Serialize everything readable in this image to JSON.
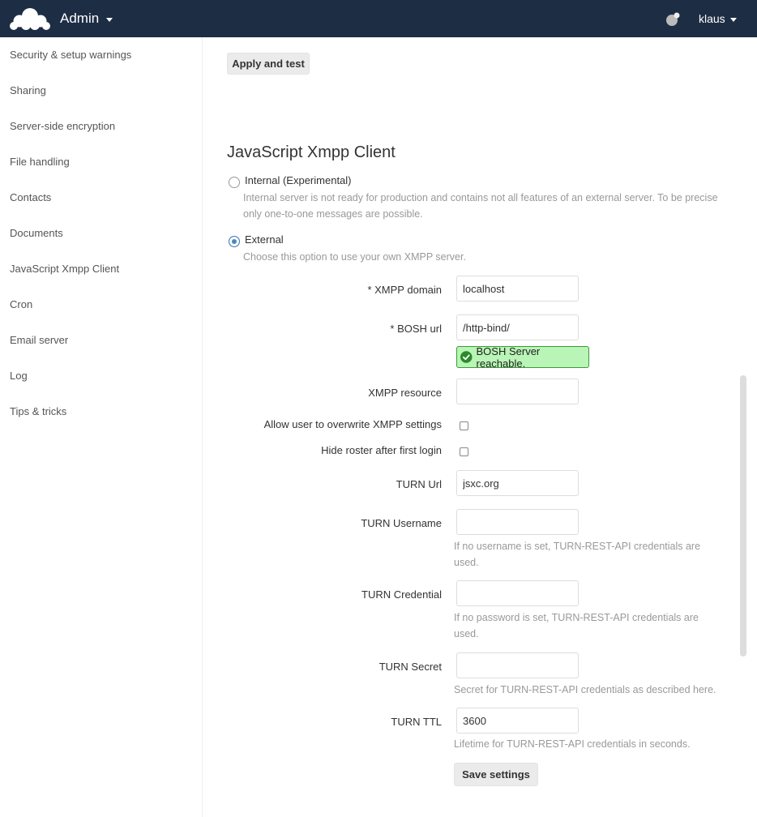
{
  "header": {
    "app_name": "Admin",
    "user": "klaus"
  },
  "sidebar": {
    "items": [
      {
        "label": "Security & setup warnings"
      },
      {
        "label": "Sharing"
      },
      {
        "label": "Server-side encryption"
      },
      {
        "label": "File handling"
      },
      {
        "label": "Contacts"
      },
      {
        "label": "Documents"
      },
      {
        "label": "JavaScript Xmpp Client"
      },
      {
        "label": "Cron"
      },
      {
        "label": "Email server"
      },
      {
        "label": "Log"
      },
      {
        "label": "Tips & tricks"
      }
    ]
  },
  "main": {
    "apply_button": "Apply and test",
    "section_title": "JavaScript Xmpp Client",
    "internal": {
      "label": "Internal (Experimental)",
      "hint": "Internal server is not ready for production and contains not all features of an external server. To be precise only one-to-one messages are possible.",
      "selected": false
    },
    "external": {
      "label": "External",
      "hint": "Choose this option to use your own XMPP server.",
      "selected": true
    },
    "fields": {
      "xmpp_domain": {
        "label": "* XMPP domain",
        "value": "localhost"
      },
      "bosh_url": {
        "label": "* BOSH url",
        "value": "/http-bind/"
      },
      "bosh_status": "BOSH Server reachable.",
      "xmpp_resource": {
        "label": "XMPP resource",
        "value": ""
      },
      "overwrite": {
        "label": "Allow user to overwrite XMPP settings",
        "checked": false
      },
      "hide_roster": {
        "label": "Hide roster after first login",
        "checked": false
      },
      "turn_url": {
        "label": "TURN Url",
        "value": "jsxc.org"
      },
      "turn_username": {
        "label": "TURN Username",
        "value": "",
        "hint": "If no username is set, TURN-REST-API credentials are used."
      },
      "turn_credential": {
        "label": "TURN Credential",
        "value": "",
        "hint": "If no password is set, TURN-REST-API credentials are used."
      },
      "turn_secret": {
        "label": "TURN Secret",
        "value": "",
        "hint": "Secret for TURN-REST-API credentials as described here."
      },
      "turn_ttl": {
        "label": "TURN TTL",
        "value": "3600",
        "hint": "Lifetime for TURN-REST-API credentials in seconds."
      }
    },
    "save_button": "Save settings"
  },
  "colors": {
    "header_bg": "#1d2d44",
    "success_bg": "#b9f5b6",
    "success_border": "#3c9b38"
  }
}
